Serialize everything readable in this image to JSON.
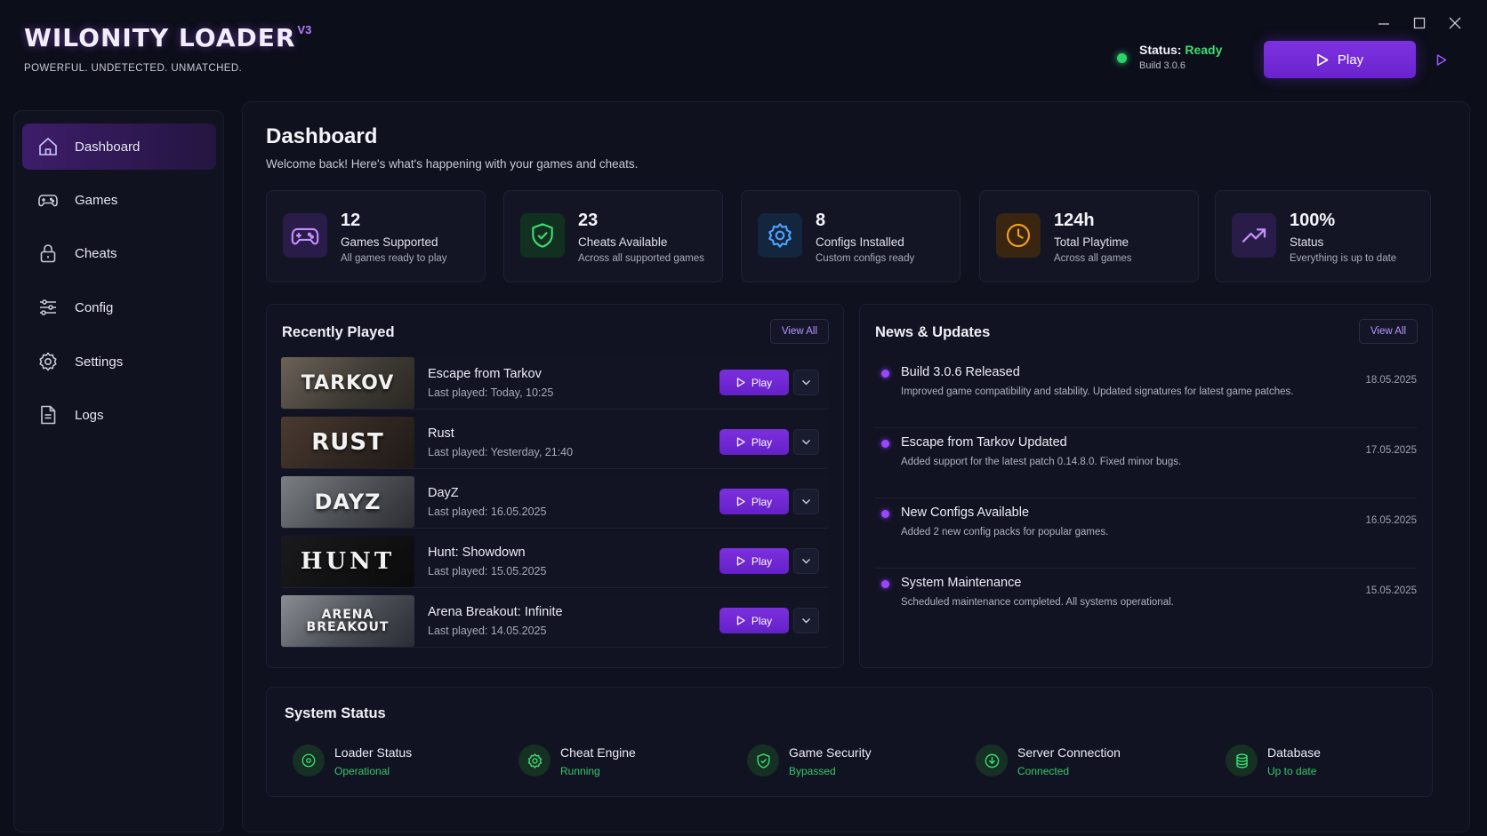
{
  "app": {
    "title": "WILONITY LOADER",
    "version": "V3",
    "tagline": "POWERFUL. UNDETECTED. UNMATCHED."
  },
  "header": {
    "status_prefix": "Status:",
    "status_value": "Ready",
    "build": "Build 3.0.6",
    "play_label": "Play"
  },
  "sidebar": {
    "items": [
      {
        "label": "Dashboard",
        "icon": "home-icon",
        "active": true
      },
      {
        "label": "Games",
        "icon": "gamepad-icon",
        "active": false
      },
      {
        "label": "Cheats",
        "icon": "lock-icon",
        "active": false
      },
      {
        "label": "Config",
        "icon": "sliders-icon",
        "active": false
      },
      {
        "label": "Settings",
        "icon": "gear-icon",
        "active": false
      },
      {
        "label": "Logs",
        "icon": "document-icon",
        "active": false
      }
    ]
  },
  "dashboard": {
    "title": "Dashboard",
    "subtitle": "Welcome back! Here's what's happening with your games and cheats."
  },
  "stats": [
    {
      "value": "12",
      "label": "Games Supported",
      "sub": "All games ready to play",
      "icon": "gamepad-icon",
      "color": "#b77dff"
    },
    {
      "value": "23",
      "label": "Cheats Available",
      "sub": "Across all supported games",
      "icon": "shield-check-icon",
      "color": "#3ddc72"
    },
    {
      "value": "8",
      "label": "Configs Installed",
      "sub": "Custom configs ready",
      "icon": "gear-icon",
      "color": "#4aa3ff"
    },
    {
      "value": "124h",
      "label": "Total Playtime",
      "sub": "Across all games",
      "icon": "clock-icon",
      "color": "#f0a020"
    },
    {
      "value": "100%",
      "label": "Status",
      "sub": "Everything is up to date",
      "icon": "trending-up-icon",
      "color": "#b77dff"
    }
  ],
  "recently_played": {
    "title": "Recently Played",
    "view_all": "View All",
    "play_label": "Play",
    "games": [
      {
        "name": "Escape from Tarkov",
        "last_played": "Last played: Today, 10:25",
        "thumb_text": "TARKOV"
      },
      {
        "name": "Rust",
        "last_played": "Last played: Yesterday, 21:40",
        "thumb_text": "RUST"
      },
      {
        "name": "DayZ",
        "last_played": "Last played: 16.05.2025",
        "thumb_text": "DAYZ"
      },
      {
        "name": "Hunt: Showdown",
        "last_played": "Last played: 15.05.2025",
        "thumb_text": "HUNT"
      },
      {
        "name": "Arena Breakout: Infinite",
        "last_played": "Last played: 14.05.2025",
        "thumb_text": "ARENA BREAKOUT"
      }
    ]
  },
  "news": {
    "title": "News & Updates",
    "view_all": "View All",
    "items": [
      {
        "title": "Build 3.0.6 Released",
        "body": "Improved game compatibility and stability. Updated signatures for latest game patches.",
        "date": "18.05.2025"
      },
      {
        "title": "Escape from Tarkov Updated",
        "body": "Added support for the latest patch 0.14.8.0. Fixed minor bugs.",
        "date": "17.05.2025"
      },
      {
        "title": "New Configs Available",
        "body": "Added 2 new config packs for popular games.",
        "date": "16.05.2025"
      },
      {
        "title": "System Maintenance",
        "body": "Scheduled maintenance completed. All systems operational.",
        "date": "15.05.2025"
      }
    ]
  },
  "system_status": {
    "title": "System Status",
    "items": [
      {
        "label": "Loader Status",
        "value": "Operational",
        "icon": "power-icon"
      },
      {
        "label": "Cheat Engine",
        "value": "Running",
        "icon": "gear-icon"
      },
      {
        "label": "Game Security",
        "value": "Bypassed",
        "icon": "shield-check-icon"
      },
      {
        "label": "Server Connection",
        "value": "Connected",
        "icon": "download-icon"
      },
      {
        "label": "Database",
        "value": "Up to date",
        "icon": "database-icon"
      }
    ]
  }
}
